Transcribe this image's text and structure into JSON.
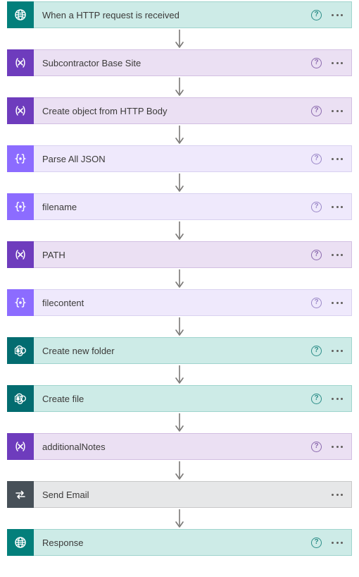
{
  "flow": {
    "steps": [
      {
        "id": "step-trigger",
        "label": "When a HTTP request is received",
        "theme": "teal",
        "icon": "globe",
        "hasHelp": true
      },
      {
        "id": "step-subcontractor-site",
        "label": "Subcontractor Base Site",
        "theme": "purple-dark",
        "icon": "variable",
        "hasHelp": true
      },
      {
        "id": "step-create-object",
        "label": "Create object from HTTP Body",
        "theme": "purple-dark",
        "icon": "variable",
        "hasHelp": true
      },
      {
        "id": "step-parse-json",
        "label": "Parse All JSON",
        "theme": "purple-light",
        "icon": "braces",
        "hasHelp": true
      },
      {
        "id": "step-filename",
        "label": "filename",
        "theme": "purple-light",
        "icon": "braces",
        "hasHelp": true
      },
      {
        "id": "step-path",
        "label": "PATH",
        "theme": "purple-dark",
        "icon": "variable",
        "hasHelp": true
      },
      {
        "id": "step-filecontent",
        "label": "filecontent",
        "theme": "purple-light",
        "icon": "braces",
        "hasHelp": true
      },
      {
        "id": "step-create-folder",
        "label": "Create new folder",
        "theme": "teal-dark",
        "icon": "sharepoint",
        "hasHelp": true
      },
      {
        "id": "step-create-file",
        "label": "Create file",
        "theme": "teal-dark",
        "icon": "sharepoint",
        "hasHelp": true
      },
      {
        "id": "step-additional-notes",
        "label": "additionalNotes",
        "theme": "purple-dark",
        "icon": "variable",
        "hasHelp": true
      },
      {
        "id": "step-send-email",
        "label": "Send Email",
        "theme": "grey",
        "icon": "swap",
        "hasHelp": false
      },
      {
        "id": "step-response",
        "label": "Response",
        "theme": "teal",
        "icon": "globe",
        "hasHelp": true
      }
    ]
  }
}
